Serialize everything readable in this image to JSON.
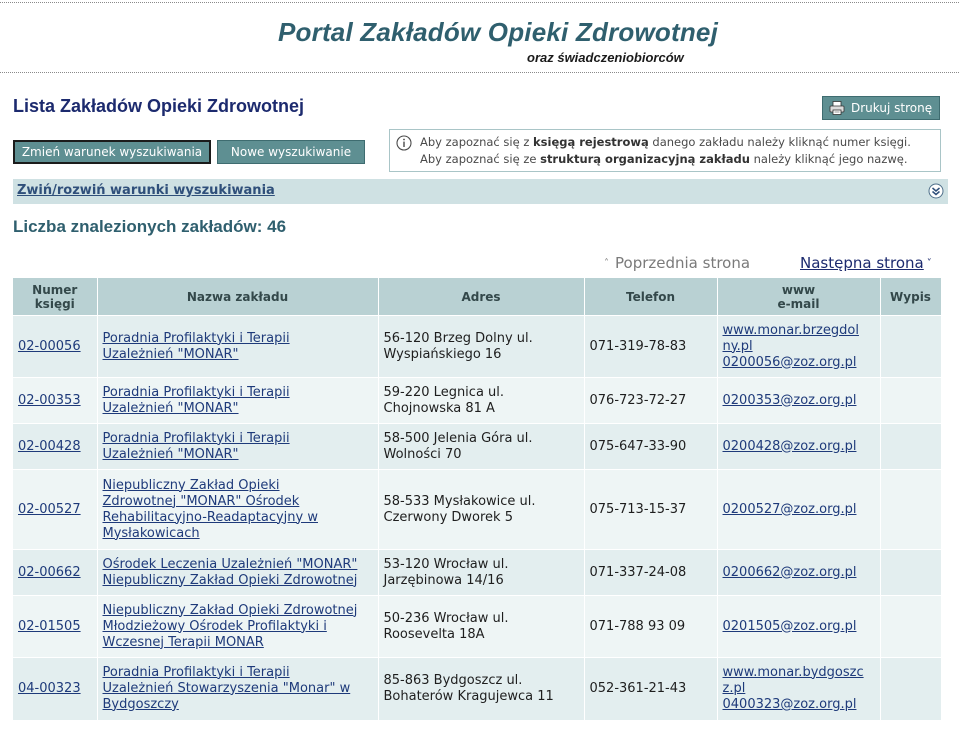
{
  "header": {
    "title": "Portal Zakładów Opieki Zdrowotnej",
    "subtitle": "oraz świadczeniobiorców"
  },
  "page": {
    "heading": "Lista Zakładów Opieki Zdrowotnej",
    "print_label": "Drukuj stronę",
    "change_search_label": "Zmień warunek wyszukiwania",
    "new_search_label": "Nowe wyszukiwanie",
    "info": {
      "line1_pre": "Aby zapoznać się z ",
      "line1_bold": "księgą rejestrową",
      "line1_post": " danego zakładu należy kliknąć numer księgi.",
      "line2_pre": "Aby zapoznać się ze ",
      "line2_bold": "strukturą organizacyjną zakładu",
      "line2_post": " należy kliknąć jego nazwę."
    },
    "toggle_label": "Zwiń/rozwiń warunki wyszukiwania",
    "results_count": "Liczba znalezionych zakładów: 46",
    "prev_page": "Poprzednia strona",
    "next_page": "Następna strona"
  },
  "table": {
    "headers": {
      "number_line1": "Numer",
      "number_line2": "księgi",
      "name": "Nazwa zakładu",
      "address": "Adres",
      "phone": "Telefon",
      "www_line1": "www",
      "www_line2": "e-mail",
      "extract": "Wypis"
    },
    "rows": [
      {
        "number": "02-00056",
        "name": [
          "Poradnia Profilaktyki i Terapii",
          "Uzależnień \"MONAR\""
        ],
        "address": [
          "56-120 Brzeg Dolny ul.",
          "Wyspiańskiego 16"
        ],
        "phone": "071-319-78-83",
        "web": [
          "www.monar.brzegdol",
          "ny.pl",
          "0200056@zoz.org.pl"
        ]
      },
      {
        "number": "02-00353",
        "name": [
          "Poradnia Profilaktyki i Terapii",
          "Uzależnień \"MONAR\""
        ],
        "address": [
          "59-220 Legnica ul.",
          "Chojnowska 81 A"
        ],
        "phone": "076-723-72-27",
        "web": [
          "0200353@zoz.org.pl"
        ]
      },
      {
        "number": "02-00428",
        "name": [
          "Poradnia Profilaktyki i Terapii",
          "Uzależnień \"MONAR\""
        ],
        "address": [
          "58-500 Jelenia Góra ul.",
          "Wolności 70"
        ],
        "phone": "075-647-33-90",
        "web": [
          "0200428@zoz.org.pl"
        ]
      },
      {
        "number": "02-00527",
        "name": [
          "Niepubliczny Zakład Opieki",
          "Zdrowotnej \"MONAR\" Ośrodek",
          "Rehabilitacyjno-Readaptacyjny w",
          "Mysłakowicach"
        ],
        "address": [
          "58-533 Mysłakowice ul.",
          "Czerwony Dworek 5"
        ],
        "phone": "075-713-15-37",
        "web": [
          "0200527@zoz.org.pl"
        ]
      },
      {
        "number": "02-00662",
        "name": [
          "Ośrodek Leczenia Uzależnień \"MONAR\"",
          "Niepubliczny Zakład Opieki Zdrowotnej"
        ],
        "address": [
          "53-120 Wrocław ul.",
          "Jarzębinowa 14/16"
        ],
        "phone": "071-337-24-08",
        "web": [
          "0200662@zoz.org.pl"
        ]
      },
      {
        "number": "02-01505",
        "name": [
          "Niepubliczny Zakład Opieki Zdrowotnej",
          "Młodzieżowy Ośrodek Profilaktyki i",
          "Wczesnej Terapii MONAR"
        ],
        "address": [
          "50-236 Wrocław ul.",
          "Roosevelta 18A"
        ],
        "phone": "071-788 93 09",
        "web": [
          "0201505@zoz.org.pl"
        ]
      },
      {
        "number": "04-00323",
        "name": [
          "Poradnia Profilaktyki i Terapii",
          "Uzależnień Stowarzyszenia \"Monar\" w",
          "Bydgoszczy"
        ],
        "address": [
          "85-863 Bydgoszcz ul.",
          "Bohaterów Kragujewca 11"
        ],
        "phone": "052-361-21-43",
        "web": [
          "www.monar.bydgoszc",
          "z.pl",
          "0400323@zoz.org.pl"
        ]
      }
    ]
  }
}
